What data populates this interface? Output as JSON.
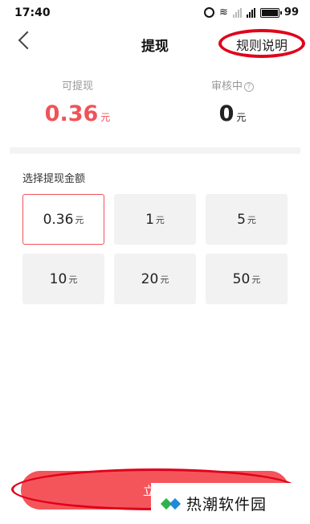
{
  "status_bar": {
    "time": "17:40",
    "battery": "99"
  },
  "header": {
    "title": "提现",
    "rules_label": "规则说明"
  },
  "balance": {
    "available_label": "可提现",
    "available_value": "0.36",
    "available_unit": "元",
    "review_label": "审核中",
    "review_value": "0",
    "review_unit": "元"
  },
  "section_label": "选择提现金额",
  "amounts": [
    {
      "value": "0.36",
      "unit": "元"
    },
    {
      "value": "1",
      "unit": "元"
    },
    {
      "value": "5",
      "unit": "元"
    },
    {
      "value": "10",
      "unit": "元"
    },
    {
      "value": "20",
      "unit": "元"
    },
    {
      "value": "50",
      "unit": "元"
    }
  ],
  "selected_amount": "0.36",
  "withdraw_label": "立即",
  "watermark": "热潮软件园",
  "colors": {
    "accent": "#f05359",
    "button": "#f4555b",
    "annotation": "#e0001a"
  }
}
